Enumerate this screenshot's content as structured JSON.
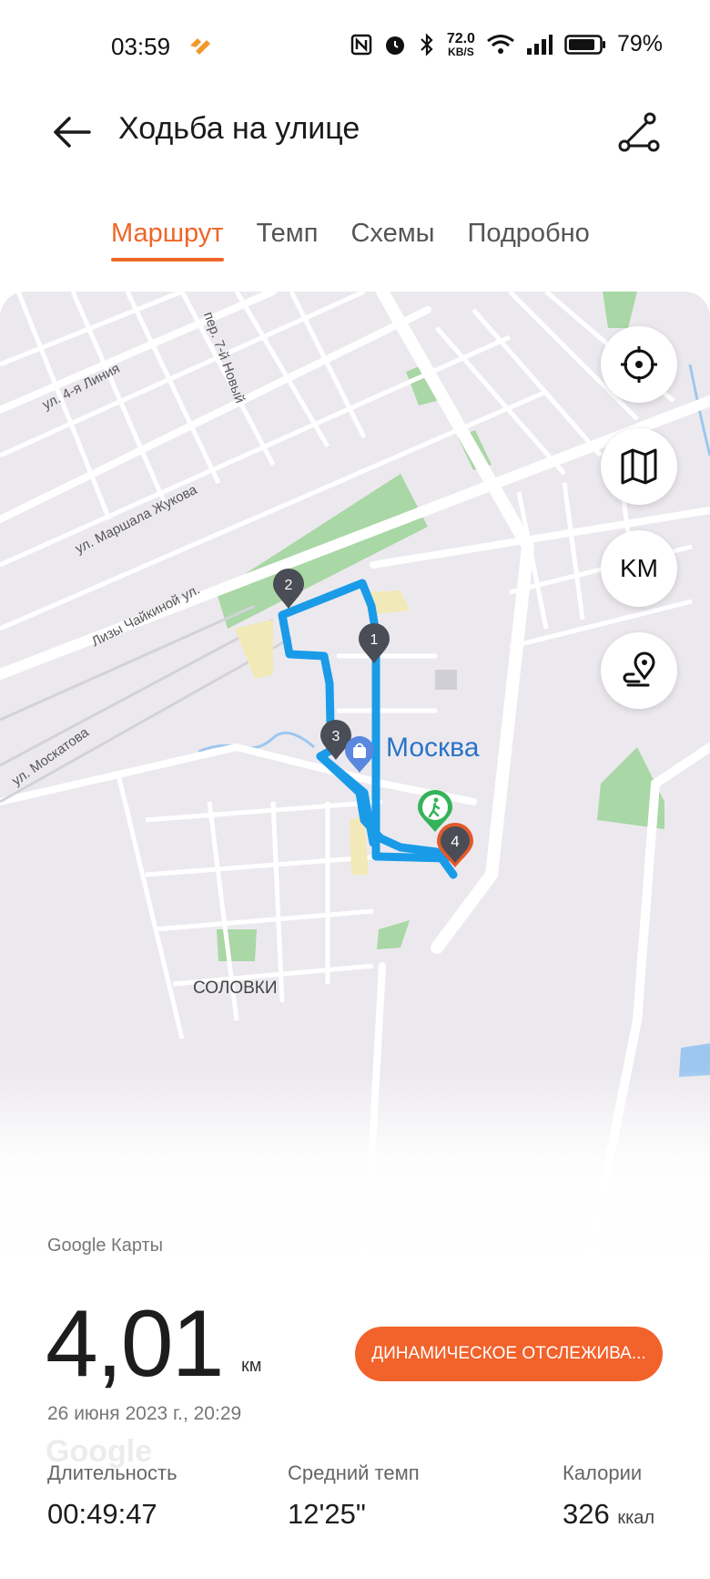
{
  "status_bar": {
    "time": "03:59",
    "net_speed_value": "72.0",
    "net_speed_unit": "KB/S",
    "battery": "79%",
    "icons": [
      "huawei-health-icon",
      "nfc-icon",
      "alarm-icon",
      "bluetooth-icon",
      "wifi-icon",
      "signal-icon",
      "battery-icon"
    ]
  },
  "header": {
    "title": "Ходьба на улице"
  },
  "tabs": [
    {
      "label": "Маршрут",
      "active": true
    },
    {
      "label": "Темп",
      "active": false
    },
    {
      "label": "Схемы",
      "active": false
    },
    {
      "label": "Подробно",
      "active": false
    }
  ],
  "map": {
    "unit_button": "KM",
    "city_label": "Москва",
    "district_label": "СОЛОВКИ",
    "streets": [
      "ул. 4-я Линия",
      "пер. 7-й Новый",
      "ул. Маршала Жукова",
      "Лизы Чайкиной ул.",
      "ул. Москатова"
    ],
    "route_markers": [
      "1",
      "2",
      "3",
      "4"
    ],
    "attribution": "Google Карты",
    "google_logo": "Google",
    "route_color": "#1a9be8",
    "marker_color": "#4a4d55",
    "end_marker_color": "#e2592a",
    "start_marker_color": "#34b35a"
  },
  "summary": {
    "distance": "4,01",
    "distance_unit": "км",
    "date": "26 июня 2023 г., 20:29",
    "dynamic_tracking_button": "ДИНАМИЧЕСКОЕ ОТСЛЕЖИВА..."
  },
  "stats": {
    "duration_label": "Длительность",
    "duration_value": "00:49:47",
    "pace_label": "Средний темп",
    "pace_value": "12'25\"",
    "calories_label": "Калории",
    "calories_value": "326",
    "calories_unit": "ккал"
  },
  "accent_color": "#ef6627"
}
